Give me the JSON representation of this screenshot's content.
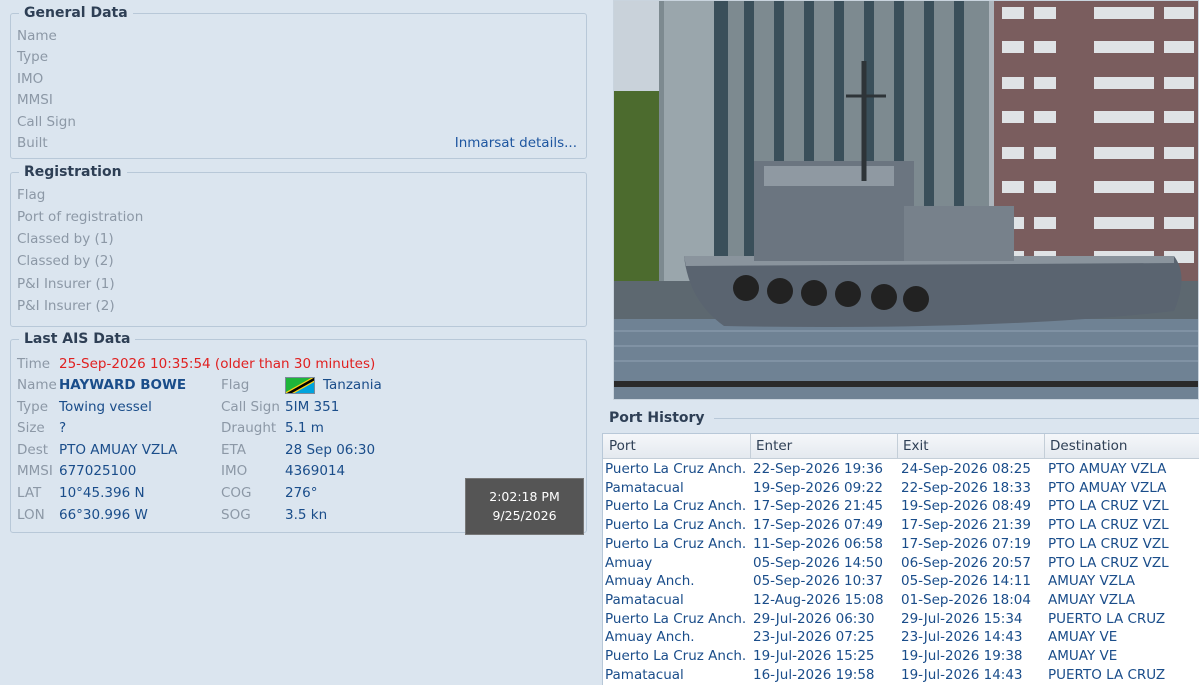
{
  "general": {
    "title": "General Data",
    "labels": [
      "Name",
      "Type",
      "IMO",
      "MMSI",
      "Call Sign",
      "Built"
    ],
    "inmarsat_link": "Inmarsat details..."
  },
  "registration": {
    "title": "Registration",
    "labels": [
      "Flag",
      "Port of registration",
      "Classed by (1)",
      "Classed by (2)",
      "P&I Insurer (1)",
      "P&I Insurer (2)"
    ]
  },
  "ais": {
    "title": "Last AIS Data",
    "time_label": "Time",
    "time_value": "25-Sep-2026 10:35:54 (older than 30 minutes)",
    "name_label": "Name",
    "name_value": "HAYWARD  BOWE",
    "flag_label": "Flag",
    "flag_value": "Tanzania",
    "type_label": "Type",
    "type_value": "Towing vessel",
    "callsign_label": "Call Sign",
    "callsign_value": "5IM 351",
    "size_label": "Size",
    "size_value": "?",
    "draught_label": "Draught",
    "draught_value": "5.1 m",
    "dest_label": "Dest",
    "dest_value": "PTO  AMUAY  VZLA",
    "eta_label": "ETA",
    "eta_value": "28 Sep 06:30",
    "mmsi_label": "MMSI",
    "mmsi_value": "677025100",
    "imo_label": "IMO",
    "imo_value": "4369014",
    "lat_label": "LAT",
    "lat_value": "10°45.396 N",
    "cog_label": "COG",
    "cog_value": "276°",
    "lon_label": "LON",
    "lon_value": "66°30.996 W",
    "sog_label": "SOG",
    "sog_value": "3.5 kn"
  },
  "tooltip": {
    "time": "2:02:18 PM",
    "date": "9/25/2026"
  },
  "port_history": {
    "title": "Port History",
    "columns": [
      "Port",
      "Enter",
      "Exit",
      "Destination"
    ],
    "rows": [
      [
        "Puerto La Cruz Anch.",
        "22-Sep-2026 19:36",
        "24-Sep-2026 08:25",
        "PTO  AMUAY  VZLA"
      ],
      [
        "Pamatacual",
        "19-Sep-2026 09:22",
        "22-Sep-2026 18:33",
        "PTO  AMUAY  VZLA"
      ],
      [
        "Puerto La Cruz Anch.",
        "17-Sep-2026 21:45",
        "19-Sep-2026 08:49",
        "PTO  LA  CRUZ  VZL"
      ],
      [
        "Puerto La Cruz Anch.",
        "17-Sep-2026 07:49",
        "17-Sep-2026 21:39",
        "PTO  LA  CRUZ  VZL"
      ],
      [
        "Puerto La Cruz Anch.",
        "11-Sep-2026 06:58",
        "17-Sep-2026 07:19",
        "PTO  LA  CRUZ  VZL"
      ],
      [
        "Amuay",
        "05-Sep-2026 14:50",
        "06-Sep-2026 20:57",
        "PTO  LA  CRUZ  VZL"
      ],
      [
        "Amuay Anch.",
        "05-Sep-2026 10:37",
        "05-Sep-2026 14:11",
        "AMUAY   VZLA"
      ],
      [
        "Pamatacual",
        "12-Aug-2026 15:08",
        "01-Sep-2026 18:04",
        "AMUAY   VZLA"
      ],
      [
        "Puerto La Cruz Anch.",
        "29-Jul-2026 06:30",
        "29-Jul-2026 15:34",
        "PUERTO LA CRUZ"
      ],
      [
        "Amuay Anch.",
        "23-Jul-2026 07:25",
        "23-Jul-2026 14:43",
        "AMUAY VE"
      ],
      [
        "Puerto La Cruz Anch.",
        "19-Jul-2026 15:25",
        "19-Jul-2026 19:38",
        "AMUAY VE"
      ],
      [
        "Pamatacual",
        "16-Jul-2026 19:58",
        "19-Jul-2026 14:43",
        "PUERTO LA CRUZ"
      ]
    ]
  }
}
